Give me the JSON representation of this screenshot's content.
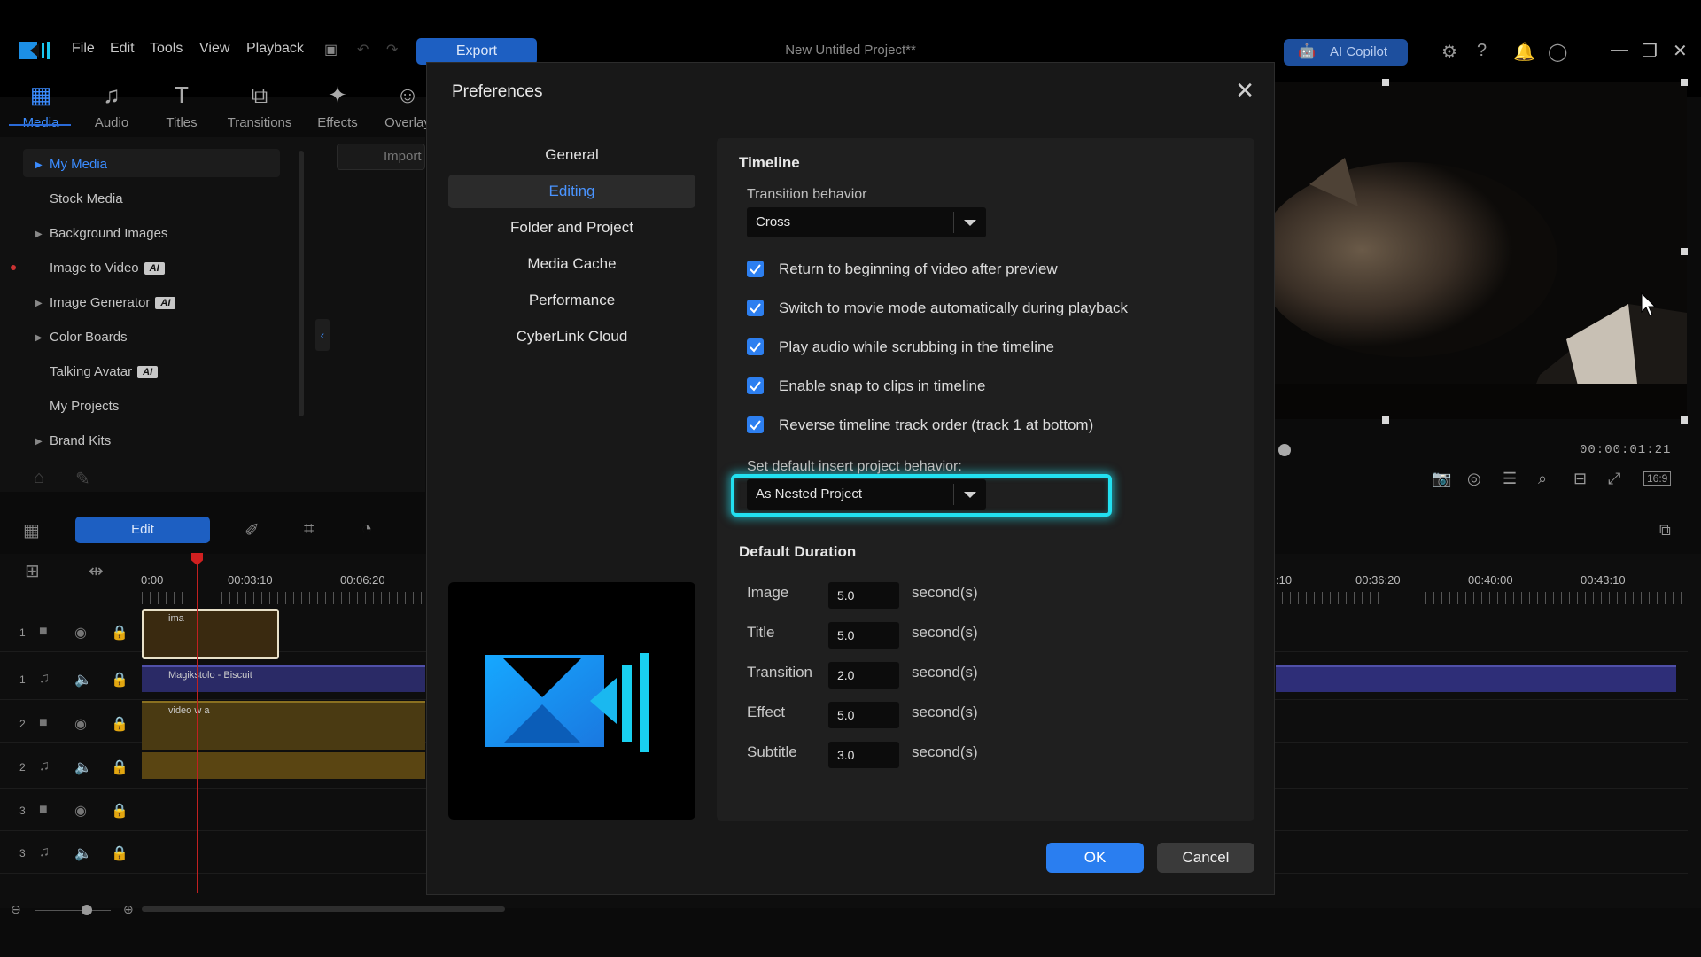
{
  "menu": {
    "items": [
      "File",
      "Edit",
      "Tools",
      "View",
      "Playback"
    ],
    "export_label": "Export",
    "project_title": "New Untitled Project**",
    "copilot_label": "AI Copilot"
  },
  "rooms": [
    "Media",
    "Audio",
    "Titles",
    "Transitions",
    "Effects",
    "Overlay"
  ],
  "media_panel": {
    "items": [
      {
        "label": "My Media",
        "ai": ""
      },
      {
        "label": "Stock Media",
        "ai": ""
      },
      {
        "label": "Background Images",
        "ai": ""
      },
      {
        "label": "Image to Video",
        "ai": "AI"
      },
      {
        "label": "Image Generator",
        "ai": "AI"
      },
      {
        "label": "Color Boards",
        "ai": ""
      },
      {
        "label": "Talking Avatar",
        "ai": "AI"
      },
      {
        "label": "My Projects",
        "ai": ""
      },
      {
        "label": "Brand Kits",
        "ai": ""
      }
    ],
    "import_label": "Import"
  },
  "toolbar": {
    "edit_label": "Edit"
  },
  "timeline": {
    "ruler_labels": [
      "0:00",
      "00:03:10",
      "00:06:20",
      ":10",
      "00:36:20",
      "00:40:00",
      "00:43:10"
    ],
    "track_numbers": [
      "1",
      "1",
      "2",
      "2",
      "3",
      "3"
    ],
    "clips": {
      "image_clip": "ima",
      "audio_clip": "Magikstolo - Biscuit",
      "video_clip": "video w a"
    }
  },
  "preview": {
    "timecode": "00:00:01:21",
    "aspect": "16:9"
  },
  "dialog": {
    "title": "Preferences",
    "nav": [
      "General",
      "Editing",
      "Folder and Project",
      "Media Cache",
      "Performance",
      "CyberLink Cloud"
    ],
    "active_nav": "Editing",
    "timeline_section": "Timeline",
    "transition_label": "Transition behavior",
    "transition_value": "Cross",
    "checkboxes": [
      {
        "label": "Return to beginning of video after preview",
        "checked": true
      },
      {
        "label": "Switch to movie mode automatically during playback",
        "checked": true
      },
      {
        "label": "Play audio while scrubbing in the timeline",
        "checked": true
      },
      {
        "label": "Enable snap to clips in timeline",
        "checked": true
      },
      {
        "label": "Reverse timeline track order (track 1 at bottom)",
        "checked": true
      }
    ],
    "insert_label": "Set default insert project behavior:",
    "insert_value": "As Nested Project",
    "duration_section": "Default Duration",
    "durations": [
      {
        "label": "Image",
        "value": "5.0",
        "unit": "second(s)"
      },
      {
        "label": "Title",
        "value": "5.0",
        "unit": "second(s)"
      },
      {
        "label": "Transition",
        "value": "2.0",
        "unit": "second(s)"
      },
      {
        "label": "Effect",
        "value": "5.0",
        "unit": "second(s)"
      },
      {
        "label": "Subtitle",
        "value": "3.0",
        "unit": "second(s)"
      }
    ],
    "ok_label": "OK",
    "cancel_label": "Cancel"
  },
  "colors": {
    "accent": "#2a7ef0",
    "highlight": "#22e0f0",
    "background": "#181818"
  }
}
